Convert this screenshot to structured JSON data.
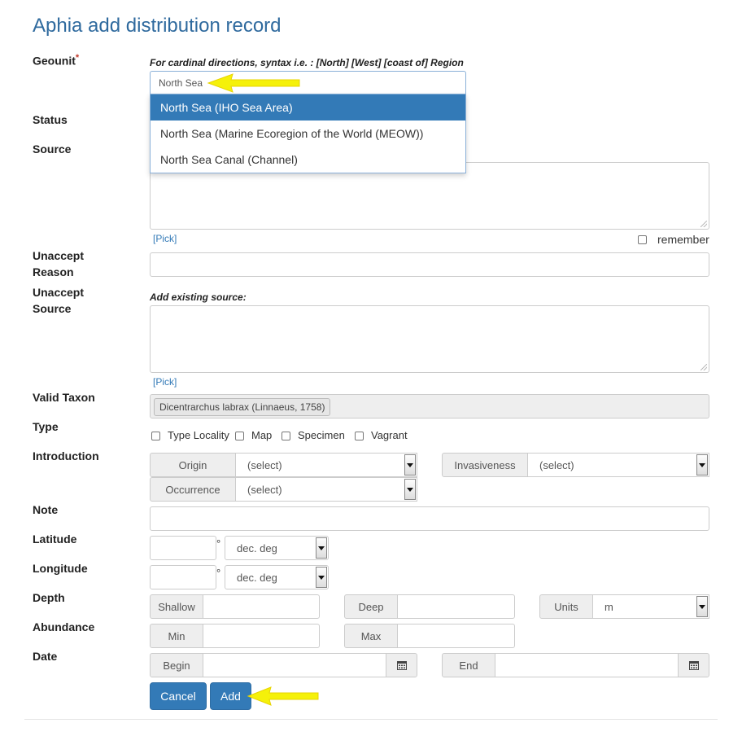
{
  "page": {
    "title": "Aphia add distribution record"
  },
  "labels": {
    "geounit": "Geounit",
    "required_mark": "*",
    "status": "Status",
    "source": "Source",
    "unaccept_reason_1": "Unaccept",
    "unaccept_reason_2": "Reason",
    "unaccept_source_1": "Unaccept",
    "unaccept_source_2": "Source",
    "valid_taxon": "Valid Taxon",
    "type": "Type",
    "introduction": "Introduction",
    "note": "Note",
    "latitude": "Latitude",
    "longitude": "Longitude",
    "depth": "Depth",
    "abundance": "Abundance",
    "date": "Date"
  },
  "geounit": {
    "hint": "For cardinal directions, syntax i.e. : [North] [West] [coast of] Region",
    "value": "North Sea",
    "suggestions": [
      "North Sea (IHO Sea Area)",
      "North Sea (Marine Ecoregion of the World (MEOW))",
      "North Sea Canal (Channel)"
    ]
  },
  "source": {
    "pick": "[Pick]",
    "remember": "remember"
  },
  "unaccept_source": {
    "hint": "Add existing source:",
    "pick": "[Pick]"
  },
  "valid_taxon": {
    "value": "Dicentrarchus labrax (Linnaeus, 1758)"
  },
  "type_options": [
    "Type Locality",
    "Map",
    "Specimen",
    "Vagrant"
  ],
  "introduction": {
    "origin_label": "Origin",
    "origin_value": "(select)",
    "invasiveness_label": "Invasiveness",
    "invasiveness_value": "(select)",
    "occurrence_label": "Occurrence",
    "occurrence_value": "(select)"
  },
  "coords": {
    "degree": "°",
    "unit": "dec. deg"
  },
  "depth": {
    "shallow": "Shallow",
    "deep": "Deep",
    "units_label": "Units",
    "units_value": "m"
  },
  "abundance": {
    "min": "Min",
    "max": "Max"
  },
  "date": {
    "begin": "Begin",
    "end": "End"
  },
  "buttons": {
    "cancel": "Cancel",
    "add": "Add"
  },
  "colors": {
    "accent": "#337ab7",
    "title": "#2f6a9e",
    "arrow": "#f5f10a"
  },
  "icons": {
    "calendar": "calendar-icon",
    "arrow": "pointer-arrow-icon"
  }
}
